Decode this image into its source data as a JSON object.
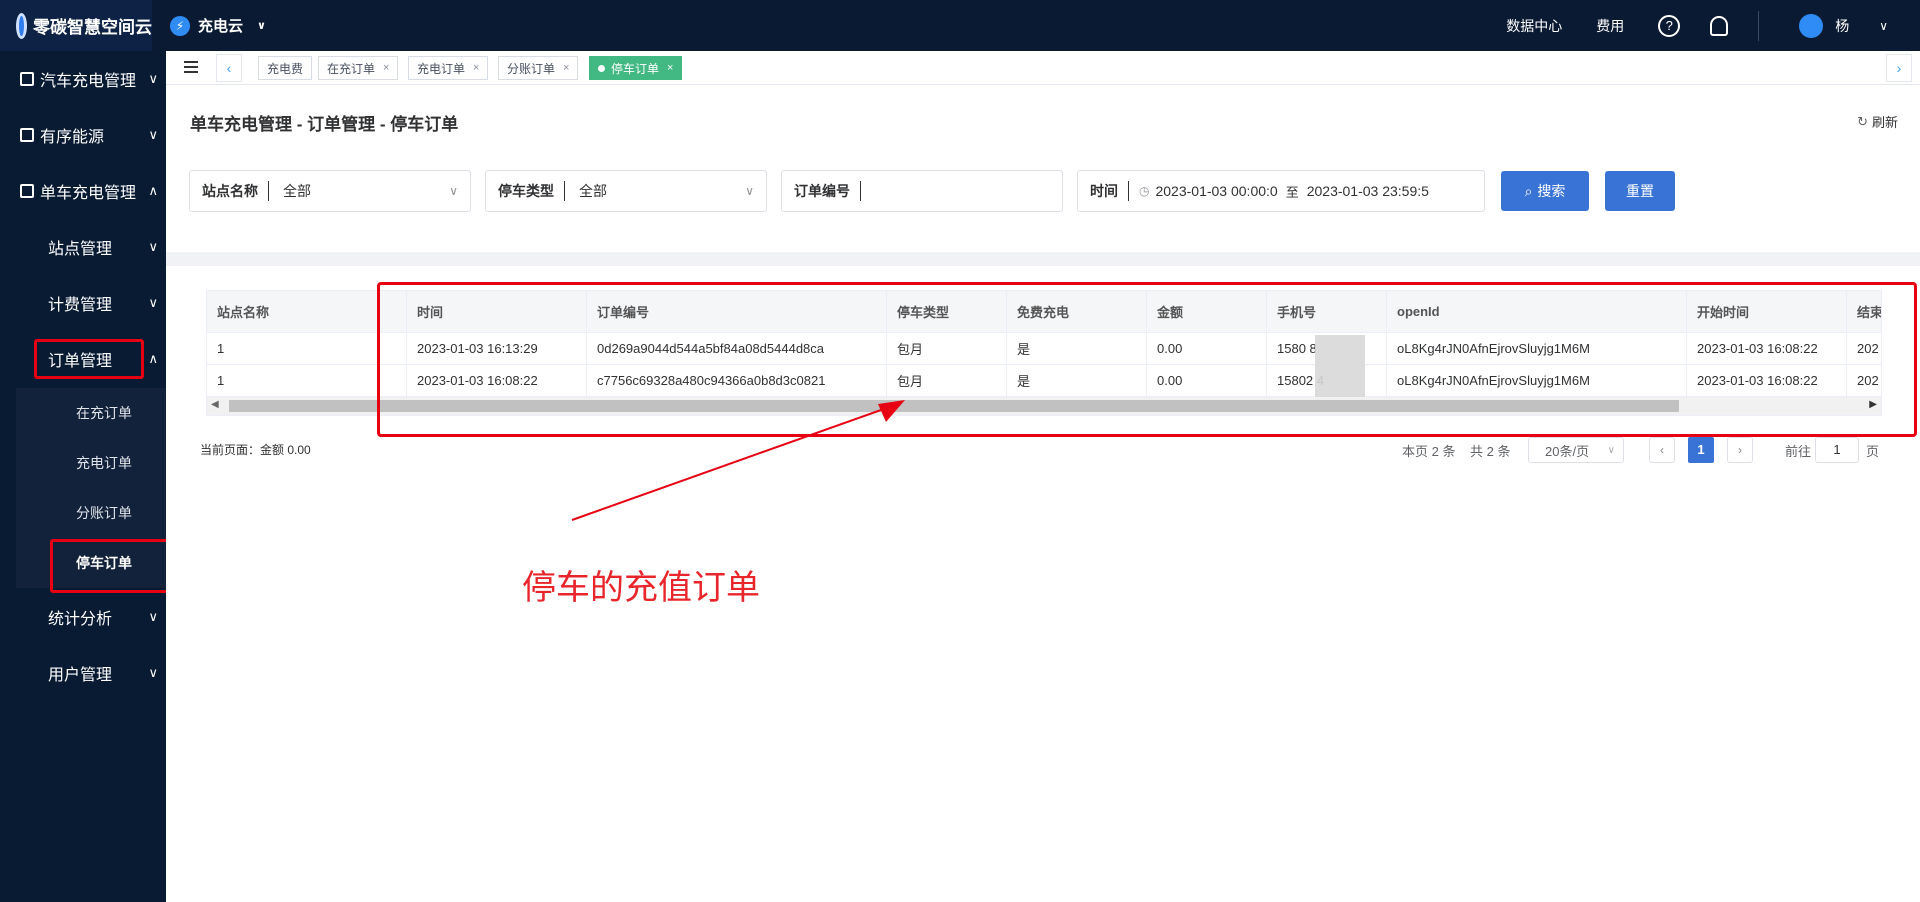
{
  "topbar": {
    "logo_text": "零碳智慧空间云",
    "product": "充电云",
    "links": [
      "数据中心",
      "费用"
    ],
    "help_icon": "question-circle-icon",
    "bell_icon": "bell-icon",
    "user": "杨"
  },
  "sidebar": {
    "menu": [
      {
        "label": "汽车充电管理",
        "icon": "grid-icon"
      },
      {
        "label": "有序能源",
        "icon": "edit-icon"
      },
      {
        "label": "单车充电管理",
        "icon": "edit-icon"
      }
    ],
    "sub": [
      "站点管理",
      "计费管理",
      "订单管理"
    ],
    "subsub": [
      "在充订单",
      "充电订单",
      "分账订单",
      "停车订单"
    ],
    "sub_after": [
      "统计分析",
      "用户管理"
    ]
  },
  "tabs": [
    {
      "label": "充电费",
      "closable": false
    },
    {
      "label": "在充订单",
      "closable": true
    },
    {
      "label": "充电订单",
      "closable": true
    },
    {
      "label": "分账订单",
      "closable": true
    },
    {
      "label": "停车订单",
      "closable": true,
      "active": true
    }
  ],
  "page": {
    "breadcrumb": "单车充电管理 - 订单管理 - 停车订单",
    "refresh": "刷新"
  },
  "filters": {
    "site_label": "站点名称",
    "site_value": "全部",
    "park_type_label": "停车类型",
    "park_type_value": "全部",
    "order_no_label": "订单编号",
    "order_no_value": "",
    "time_label": "时间",
    "time_start": "2023-01-03 00:00:0",
    "time_sep": "至",
    "time_end": "2023-01-03 23:59:5",
    "search_btn": "搜索",
    "reset_btn": "重置"
  },
  "table": {
    "columns": [
      "站点名称",
      "时间",
      "订单编号",
      "停车类型",
      "免费充电",
      "金额",
      "手机号",
      "openId",
      "开始时间",
      "结束"
    ],
    "rows": [
      [
        "1",
        "2023-01-03 16:13:29",
        "0d269a9044d544a5bf84a08d5444d8ca",
        "包月",
        "是",
        "0.00",
        "1580        8",
        "oL8Kg4rJN0AfnEjrovSluyjg1M6M",
        "2023-01-03 16:08:22",
        "202"
      ],
      [
        "1",
        "2023-01-03 16:08:22",
        "c7756c69328a480c94366a0b8d3c0821",
        "包月",
        "是",
        "0.00",
        "15802        4",
        "oL8Kg4rJN0AfnEjrovSluyjg1M6M",
        "2023-01-03 16:08:22",
        "202"
      ]
    ]
  },
  "footer": {
    "summary": "当前页面：金额 0.00",
    "page_count": "本页 2 条",
    "total": "共 2 条",
    "page_size": "20条/页",
    "current_page": "1",
    "goto_label": "前往",
    "goto_value": "1",
    "page_unit": "页"
  },
  "annotation": {
    "text": "停车的充值订单",
    "color": "#e60012"
  }
}
